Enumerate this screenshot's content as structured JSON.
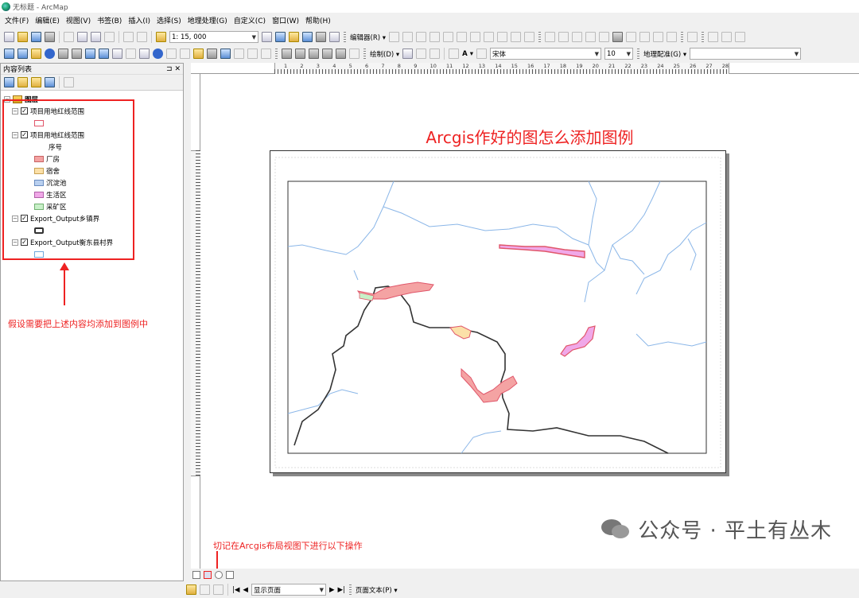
{
  "window": {
    "title": "无标题 - ArcMap"
  },
  "menu": [
    "文件(F)",
    "编辑(E)",
    "视图(V)",
    "书签(B)",
    "插入(I)",
    "选择(S)",
    "地理处理(G)",
    "自定义(C)",
    "窗口(W)",
    "帮助(H)"
  ],
  "toolbar": {
    "scale": "1: 15, 000",
    "editor_label": "编辑器(R) ▾",
    "draw_label": "绘制(D) ▾",
    "font_name": "宋体",
    "font_size": "10",
    "georef_label": "地理配准(G) ▾"
  },
  "toc": {
    "title": "内容列表",
    "pin": "⊐ ✕",
    "root_label": "图层",
    "layers": [
      {
        "name": "项目用地红线范围",
        "checked": true,
        "legend": [
          {
            "label": "",
            "fill": "#ffffff",
            "stroke": "#e0566a"
          }
        ]
      },
      {
        "name": "项目用地红线范围",
        "checked": true,
        "field": "序号",
        "legend": [
          {
            "label": "厂房",
            "fill": "#f4a3a3",
            "stroke": "#c86464"
          },
          {
            "label": "宿舍",
            "fill": "#fbe0a8",
            "stroke": "#c8a050"
          },
          {
            "label": "沉淀池",
            "fill": "#b9d0f0",
            "stroke": "#6a8cc0"
          },
          {
            "label": "生活区",
            "fill": "#f0a8e8",
            "stroke": "#b060a8"
          },
          {
            "label": "采矿区",
            "fill": "#c8f0c8",
            "stroke": "#70b070"
          }
        ]
      },
      {
        "name": "Export_Output乡镇界",
        "checked": true,
        "legend": [
          {
            "label": "",
            "fill": "#ffffff",
            "stroke": "#333333"
          }
        ]
      },
      {
        "name": "Export_Output衡东县村界",
        "checked": true,
        "legend": [
          {
            "label": "",
            "fill": "#ffffff",
            "stroke": "#6fa8dc"
          }
        ]
      }
    ]
  },
  "annotations": {
    "add_to_legend_note": "假设需要把上述内容均添加到图例中",
    "layout_view_note": "切记在Arcgis布局视图下进行以下操作"
  },
  "layout": {
    "heading": "Arcgis作好的图怎么添加图例",
    "ruler_ticks": [
      "1",
      "2",
      "3",
      "4",
      "5",
      "6",
      "7",
      "8",
      "9",
      "10",
      "11",
      "12",
      "13",
      "14",
      "15",
      "16",
      "17",
      "18",
      "19",
      "20",
      "21",
      "22",
      "23",
      "24",
      "25",
      "26",
      "27",
      "28"
    ]
  },
  "statusbar": {
    "page_combo": "显示页面",
    "page_text": "页面文本(P) ▾"
  },
  "watermark": {
    "text": "公众号 · 平土有丛木"
  }
}
